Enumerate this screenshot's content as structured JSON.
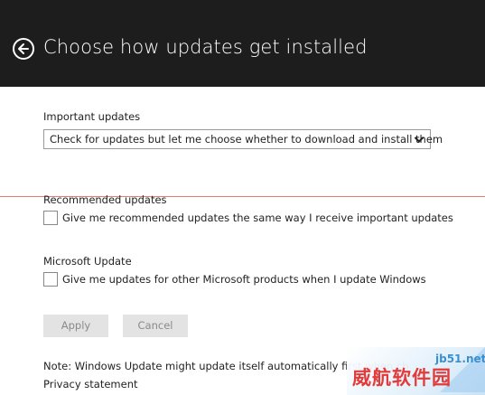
{
  "header": {
    "title": "Choose how updates get installed",
    "back_icon": "back-arrow-circle-icon"
  },
  "important_updates": {
    "label": "Important updates",
    "selected_value": "Check for updates but let me choose whether to download and install them"
  },
  "recommended_updates": {
    "label": "Recommended updates",
    "checkbox_label": "Give me recommended updates the same way I receive important updates",
    "checked": false
  },
  "microsoft_update": {
    "label": "Microsoft Update",
    "checkbox_label": "Give me updates for other Microsoft products when I update Windows",
    "checked": false
  },
  "buttons": {
    "apply": "Apply",
    "cancel": "Cancel"
  },
  "note": "Note: Windows Update might update itself automatically first when ch",
  "privacy_link": "Privacy statement",
  "watermark": {
    "url": "jb51.net",
    "text": "威航软件园"
  },
  "colors": {
    "header_bg": "#1d1d1d",
    "button_bg": "#e3e3e3",
    "button_text": "#8a8a8a",
    "divider_line": "#e67c73",
    "watermark_red": "#e33a3a",
    "watermark_blue": "#3a8fd0"
  }
}
